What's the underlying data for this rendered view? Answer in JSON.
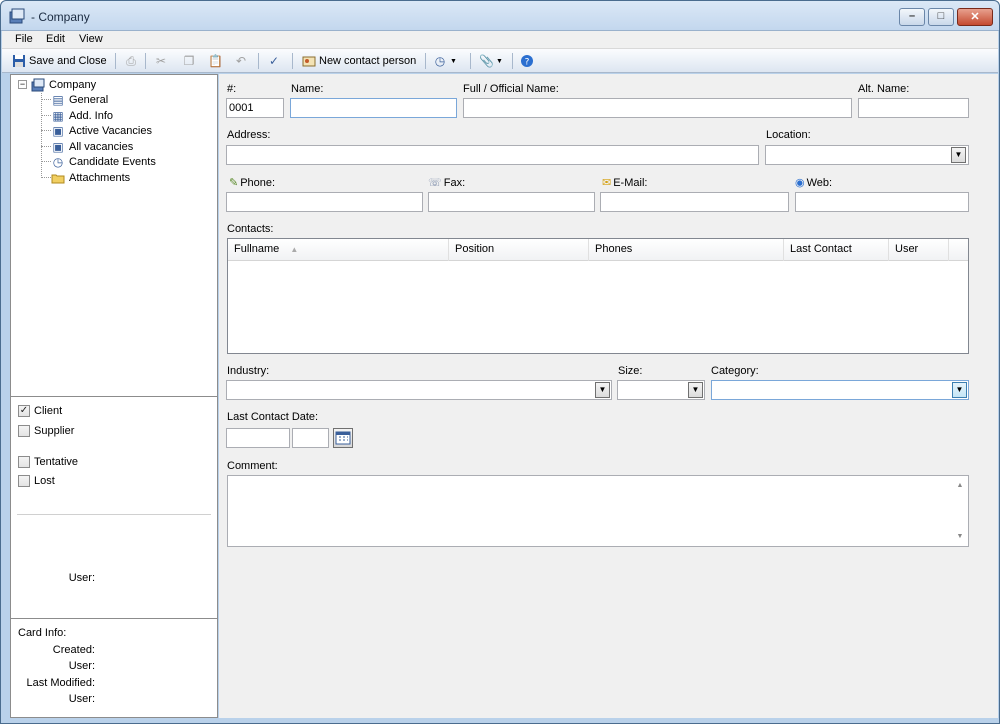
{
  "window": {
    "title": "- Company"
  },
  "menu": [
    {
      "label": "File"
    },
    {
      "label": "Edit"
    },
    {
      "label": "View"
    }
  ],
  "toolbar": {
    "save_close": "Save and Close",
    "new_contact": "New contact person"
  },
  "tree": {
    "root": "Company",
    "items": [
      {
        "label": "General"
      },
      {
        "label": "Add. Info"
      },
      {
        "label": "Active Vacancies"
      },
      {
        "label": "All vacancies"
      },
      {
        "label": "Candidate Events"
      },
      {
        "label": "Attachments"
      }
    ]
  },
  "flags": [
    {
      "label": "Client",
      "checked": true
    },
    {
      "label": "Supplier",
      "checked": false
    },
    {
      "label": "Tentative",
      "checked": false
    },
    {
      "label": "Lost",
      "checked": false
    }
  ],
  "left_user_label": "User:",
  "card_info": {
    "title": "Card Info:",
    "created": "Created:",
    "user1": "User:",
    "last_modified": "Last Modified:",
    "user2": "User:"
  },
  "form": {
    "number_label": "#:",
    "number_value": "0001",
    "name_label": "Name:",
    "full_name_label": "Full / Official Name:",
    "alt_name_label": "Alt. Name:",
    "address_label": "Address:",
    "location_label": "Location:",
    "phone_label": "Phone:",
    "fax_label": "Fax:",
    "email_label": "E-Mail:",
    "web_label": "Web:",
    "contacts_label": "Contacts:",
    "contacts_columns": [
      "Fullname",
      "Position",
      "Phones",
      "Last Contact",
      "User"
    ],
    "industry_label": "Industry:",
    "size_label": "Size:",
    "category_label": "Category:",
    "last_contact_label": "Last Contact Date:",
    "comment_label": "Comment:"
  }
}
